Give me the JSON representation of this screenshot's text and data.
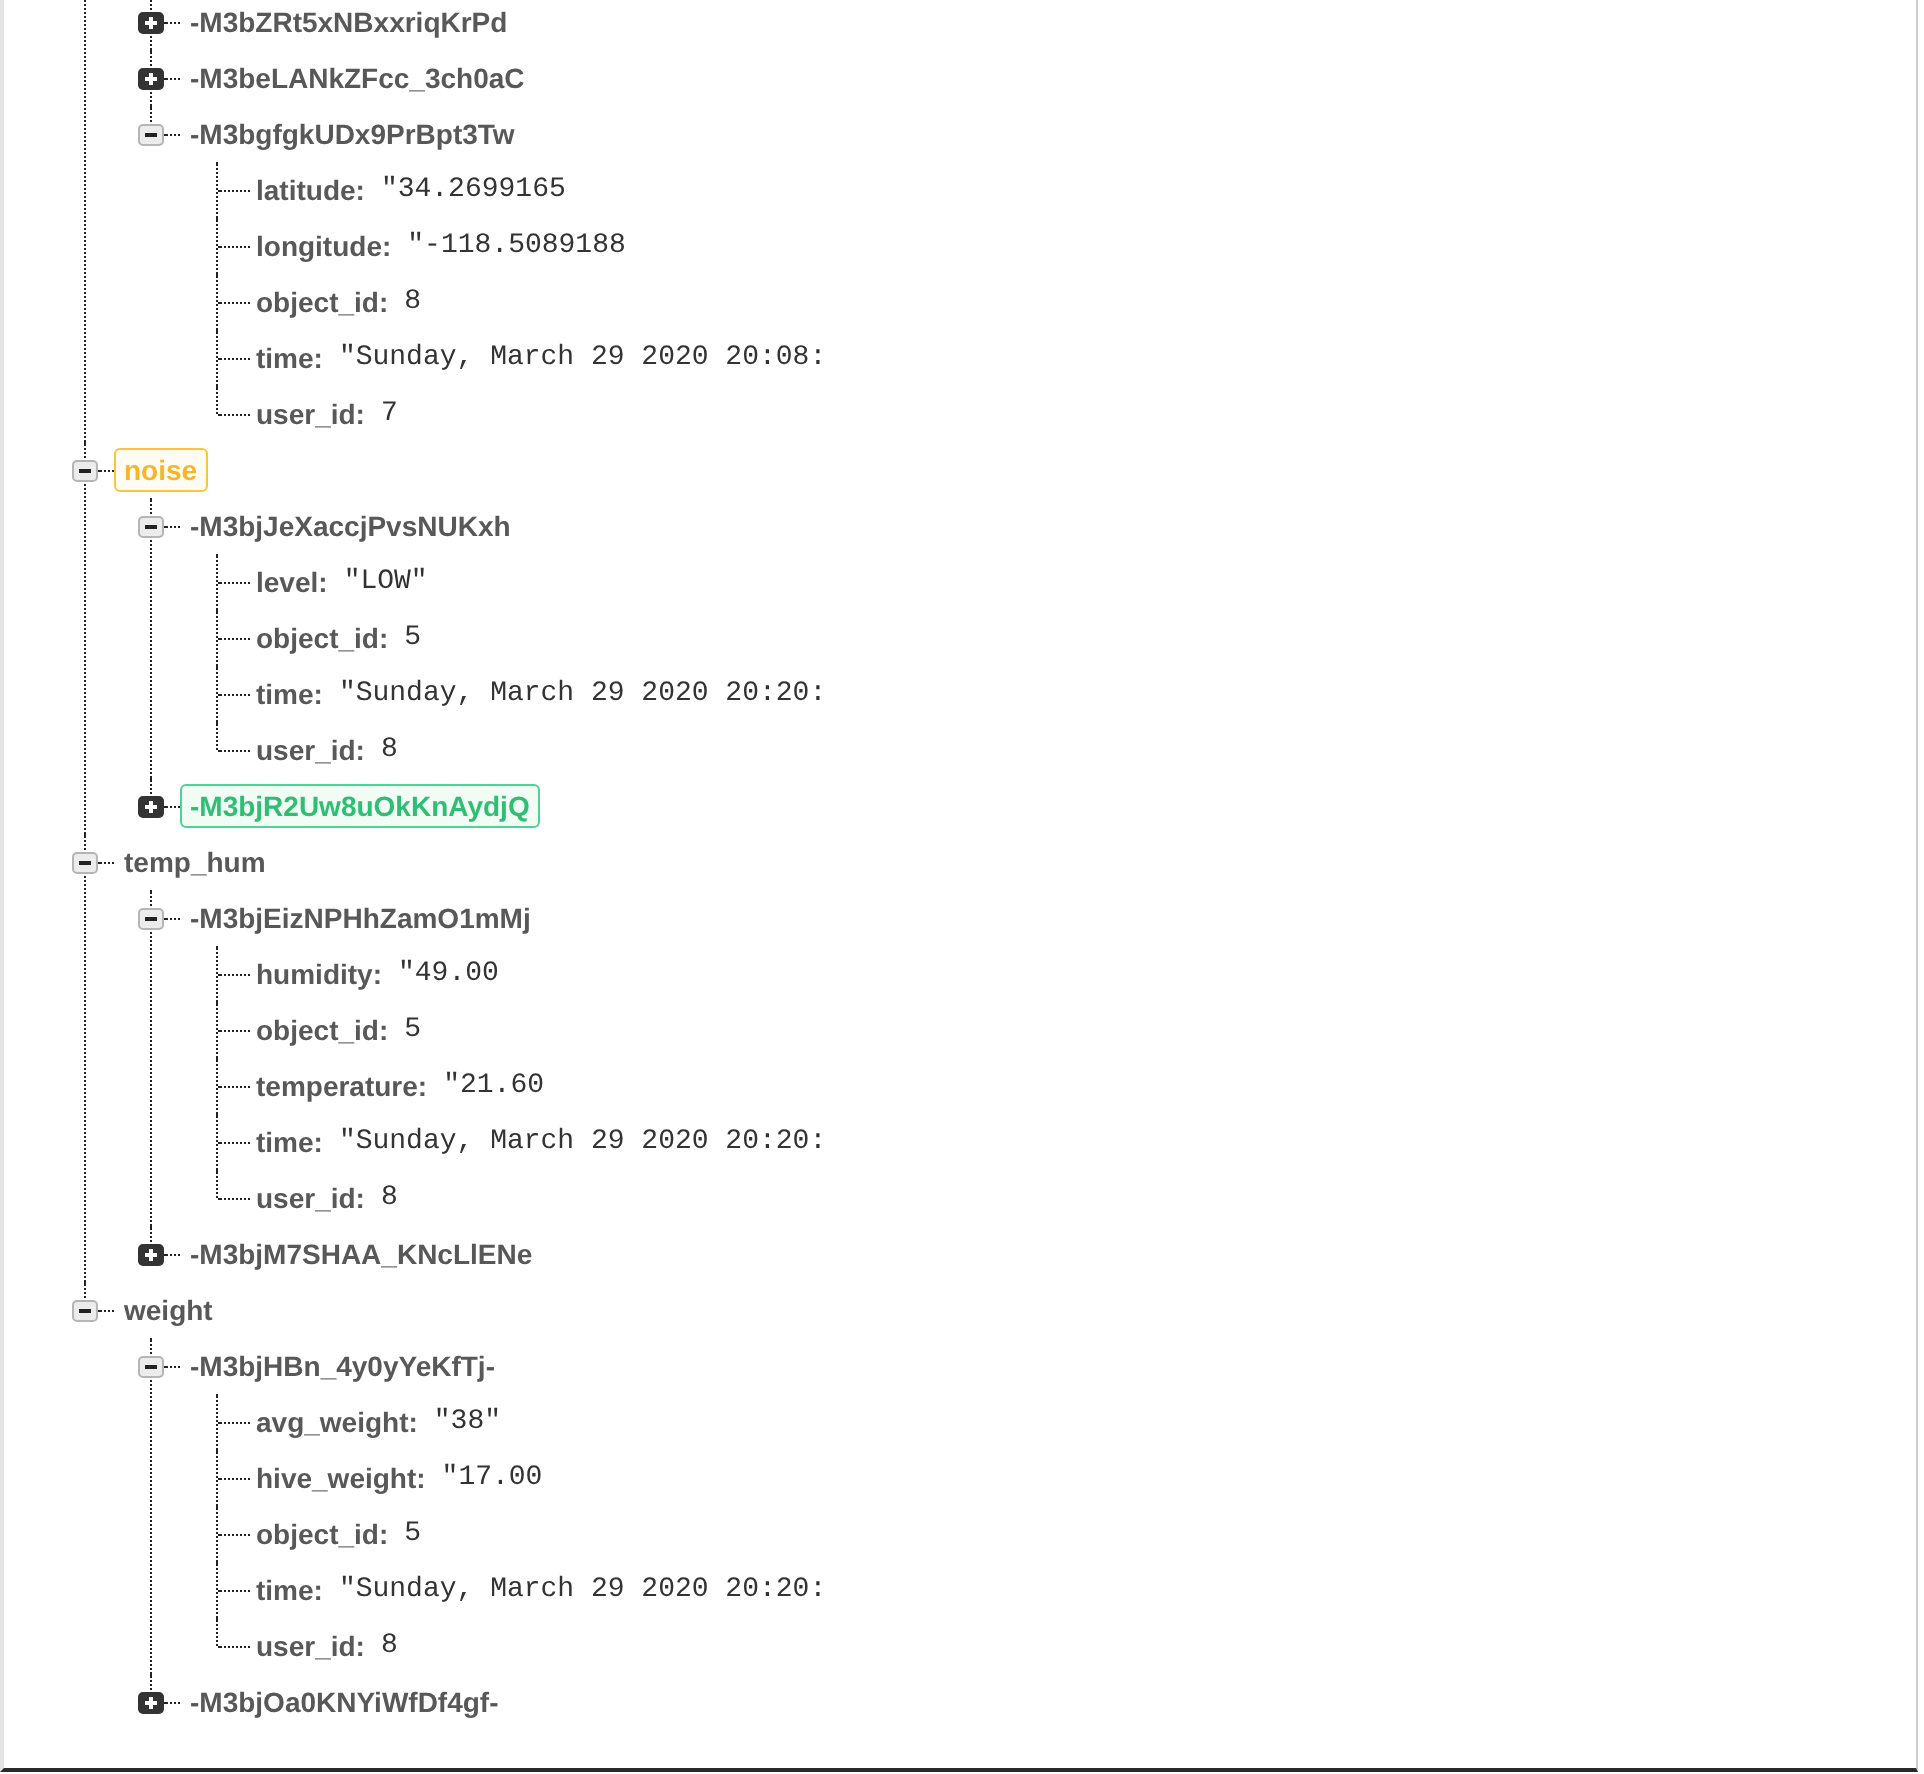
{
  "tree": {
    "scrolled_branch": {
      "children": [
        {
          "key": "-M3bZRt5xNBxxriqKrPd",
          "expanded": false
        },
        {
          "key": "-M3beLANkZFcc_3ch0aC",
          "expanded": false
        },
        {
          "key": "-M3bgfgkUDx9PrBpt3Tw",
          "expanded": true,
          "children": [
            {
              "key": "latitude:",
              "value": "\"34.2699165"
            },
            {
              "key": "longitude:",
              "value": "\"-118.5089188"
            },
            {
              "key": "object_id:",
              "value": "8"
            },
            {
              "key": "time:",
              "value": "\"Sunday, March 29 2020 20:08:"
            },
            {
              "key": "user_id:",
              "value": "7"
            }
          ]
        }
      ]
    },
    "nodes": [
      {
        "key": "noise",
        "expanded": true,
        "changed": true,
        "children": [
          {
            "key": "-M3bjJeXaccjPvsNUKxh",
            "expanded": true,
            "added": false,
            "children": [
              {
                "key": "level:",
                "value": "\"LOW\""
              },
              {
                "key": "object_id:",
                "value": "5"
              },
              {
                "key": "time:",
                "value": "\"Sunday, March 29 2020 20:20:"
              },
              {
                "key": "user_id:",
                "value": "8"
              }
            ]
          },
          {
            "key": "-M3bjR2Uw8uOkKnAydjQ",
            "expanded": false,
            "added": true
          }
        ]
      },
      {
        "key": "temp_hum",
        "expanded": true,
        "changed": false,
        "children": [
          {
            "key": "-M3bjEizNPHhZamO1mMj",
            "expanded": true,
            "children": [
              {
                "key": "humidity:",
                "value": "\"49.00"
              },
              {
                "key": "object_id:",
                "value": "5"
              },
              {
                "key": "temperature:",
                "value": "\"21.60"
              },
              {
                "key": "time:",
                "value": "\"Sunday, March 29 2020 20:20:"
              },
              {
                "key": "user_id:",
                "value": "8"
              }
            ]
          },
          {
            "key": "-M3bjM7SHAA_KNcLlENe",
            "expanded": false
          }
        ]
      },
      {
        "key": "weight",
        "expanded": true,
        "changed": false,
        "children": [
          {
            "key": "-M3bjHBn_4y0yYeKfTj-",
            "expanded": true,
            "children": [
              {
                "key": "avg_weight:",
                "value": "\"38\""
              },
              {
                "key": "hive_weight:",
                "value": "\"17.00"
              },
              {
                "key": "object_id:",
                "value": "5"
              },
              {
                "key": "time:",
                "value": "\"Sunday, March 29 2020 20:20:"
              },
              {
                "key": "user_id:",
                "value": "8"
              }
            ]
          },
          {
            "key": "-M3bjOa0KNYiWfDf4gf-",
            "expanded": false
          }
        ]
      }
    ]
  }
}
